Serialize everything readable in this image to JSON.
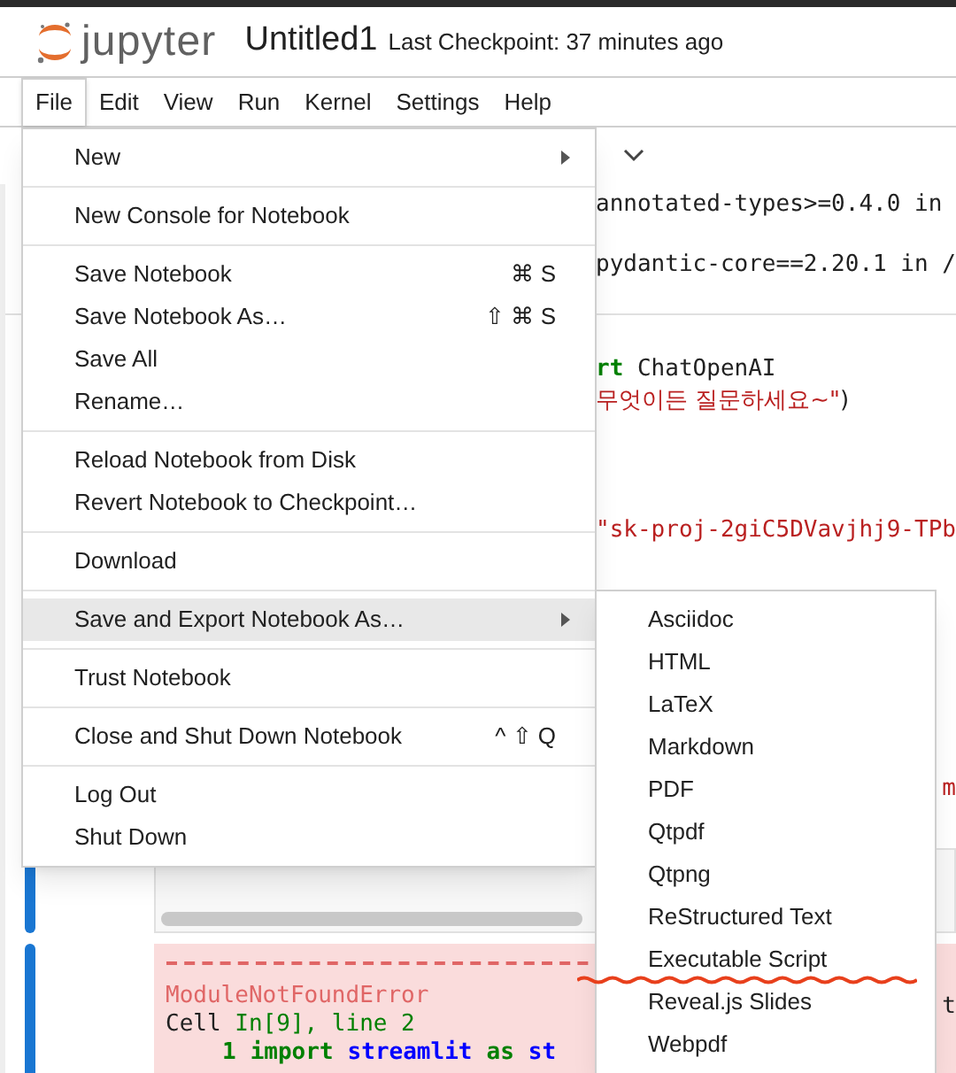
{
  "header": {
    "logo_text": "jupyter",
    "title": "Untitled1",
    "checkpoint": "Last Checkpoint: 37 minutes ago"
  },
  "menubar": [
    {
      "label": "File",
      "selected": true
    },
    {
      "label": "Edit",
      "selected": false
    },
    {
      "label": "View",
      "selected": false
    },
    {
      "label": "Run",
      "selected": false
    },
    {
      "label": "Kernel",
      "selected": false
    },
    {
      "label": "Settings",
      "selected": false
    },
    {
      "label": "Help",
      "selected": false
    }
  ],
  "file_menu": [
    [
      {
        "label": "New",
        "submenu": true,
        "highlighted": false
      }
    ],
    [
      {
        "label": "New Console for Notebook",
        "highlighted": false
      }
    ],
    [
      {
        "label": "Save Notebook",
        "shortcut": "⌘ S",
        "highlighted": false
      },
      {
        "label": "Save Notebook As…",
        "shortcut": "⇧ ⌘ S",
        "highlighted": false
      },
      {
        "label": "Save All",
        "highlighted": false
      },
      {
        "label": "Rename…",
        "highlighted": false
      }
    ],
    [
      {
        "label": "Reload Notebook from Disk",
        "highlighted": false
      },
      {
        "label": "Revert Notebook to Checkpoint…",
        "highlighted": false
      }
    ],
    [
      {
        "label": "Download",
        "highlighted": false
      }
    ],
    [
      {
        "label": "Save and Export Notebook As…",
        "submenu": true,
        "highlighted": true
      }
    ],
    [
      {
        "label": "Trust Notebook",
        "highlighted": false
      }
    ],
    [
      {
        "label": "Close and Shut Down Notebook",
        "shortcut": "^ ⇧ Q",
        "highlighted": false
      }
    ],
    [
      {
        "label": "Log Out",
        "highlighted": false
      },
      {
        "label": "Shut Down",
        "highlighted": false
      }
    ]
  ],
  "export_menu": [
    {
      "label": "Asciidoc",
      "marked": false
    },
    {
      "label": "HTML",
      "marked": false
    },
    {
      "label": "LaTeX",
      "marked": false
    },
    {
      "label": "Markdown",
      "marked": false
    },
    {
      "label": "PDF",
      "marked": false
    },
    {
      "label": "Qtpdf",
      "marked": false
    },
    {
      "label": "Qtpng",
      "marked": false
    },
    {
      "label": "ReStructured Text",
      "marked": false
    },
    {
      "label": "Executable Script",
      "marked": true
    },
    {
      "label": "Reveal.js Slides",
      "marked": false
    },
    {
      "label": "Webpdf",
      "marked": false
    }
  ],
  "notebook": {
    "output_lines": [
      "annotated-types>=0.4.0 in",
      "pydantic-core==2.20.1 in /"
    ],
    "code_lines": [
      [
        {
          "kind": "keyword",
          "text": "rt"
        },
        {
          "kind": "plain",
          "text": " ChatOpenAI"
        }
      ],
      [
        {
          "kind": "string",
          "text": "무엇이든 질문하세요~\""
        },
        {
          "kind": "plain",
          "text": ")"
        }
      ],
      [
        {
          "kind": "string",
          "text": "\"sk-proj-2giC5DVavjhj9-TPb"
        }
      ]
    ],
    "fragment_right": "m",
    "error": {
      "name": "ModuleNotFoundError",
      "cell_prefix": "Cell ",
      "cell_ref": "In[9], line 2",
      "line_no": "1",
      "tokens": [
        {
          "kind": "keyword",
          "text": "import"
        },
        {
          "kind": "name",
          "text": "streamlit"
        },
        {
          "kind": "keyword",
          "text": "as"
        },
        {
          "kind": "name",
          "text": "st"
        }
      ],
      "fragment_right": "t"
    }
  }
}
